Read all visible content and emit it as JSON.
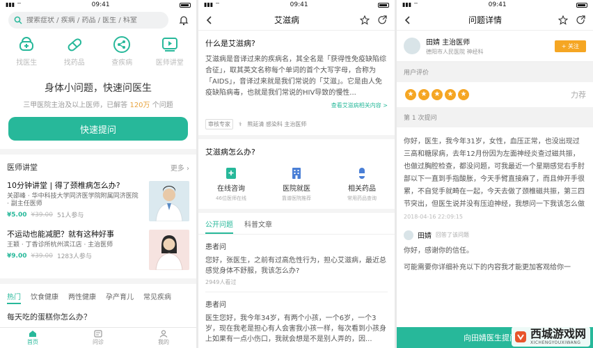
{
  "status": {
    "time": "09:41"
  },
  "home": {
    "search_placeholder": "搜索症状 / 疾病 / 药品 / 医生 / 科室",
    "categories": [
      {
        "label": "找医生",
        "icon": "doctor-icon"
      },
      {
        "label": "找药品",
        "icon": "pill-icon"
      },
      {
        "label": "查疾病",
        "icon": "share-icon"
      },
      {
        "label": "医师讲堂",
        "icon": "video-icon"
      }
    ],
    "hero_title": "身体小问题，快速问医生",
    "hero_sub_pre": "三甲医院主治及以上医师，已解答",
    "hero_sub_num": "120万",
    "hero_sub_post": "个问题",
    "ask_button": "快速提问",
    "lecture_section": "医师讲堂",
    "lecture_more": "更多",
    "lectures": [
      {
        "title": "10分钟讲堂 | 得了颈椎病怎么办?",
        "speaker": "关邵峰 · 华中科技大学同济医学院附属同济医院 · 副主任医师",
        "price": "¥5.00",
        "orig": "¥39.00",
        "count": "51人参与"
      },
      {
        "title": "不运动也能减肥？就有这种好事",
        "speaker": "王颖 · 丁香诊所杭州滨江店 · 主治医师",
        "price": "¥9.00",
        "orig": "¥39.00",
        "count": "1283人参与"
      }
    ],
    "tabs": [
      "热门",
      "饮食健康",
      "两性健康",
      "孕产育儿",
      "常见疾病"
    ],
    "cut_title": "每天吃的蛋糕你怎么办？",
    "nav": [
      {
        "label": "首页",
        "icon": "home-icon"
      },
      {
        "label": "问诊",
        "icon": "consult-icon"
      },
      {
        "label": "我的",
        "icon": "profile-icon"
      }
    ]
  },
  "disease": {
    "title": "艾滋病",
    "what_q": "什么是艾滋病?",
    "what_a": "艾滋病是音译过来的疾病名，其全名是「获得性免疫缺陷综合征」，取其英文名称每个单词的首个大写字母，合称为「AIDS」，音译过来就是我们常说的「艾滋」。它是由人免疫缺陷病毒，也就是我们常说的HIV导致的慢性...",
    "more_link": "查看艾滋病相关内容 >",
    "reviewer_tag": "审核专家",
    "reviewer": "熊延清 感染科 主治医师",
    "how_q": "艾滋病怎么办?",
    "services": [
      {
        "name": "在线咨询",
        "desc": "46位医师在线",
        "icon": "chat-plus-icon"
      },
      {
        "name": "医院就医",
        "desc": "靠谱医院推荐",
        "icon": "hospital-icon"
      },
      {
        "name": "相关药品",
        "desc": "常用药品查询",
        "icon": "medicine-icon"
      }
    ],
    "tabs": [
      "公开问题",
      "科普文章"
    ],
    "questions": [
      {
        "who": "患者问",
        "body": "您好，张医生，之前有过高危性行为，担心艾滋病，最近总感觉身体不舒服，我该怎么办?",
        "views": "2949人看过"
      },
      {
        "who": "患者问",
        "body": "医生您好，我今年34岁，有两个小孩，一个6岁，一个3岁，现在我老是担心有人会害我小孩一样，每次看到小孩身上如果有一点小伤口，我就会想是不是别人弄的，因..."
      }
    ]
  },
  "detail": {
    "title": "问题详情",
    "doctor_name": "田婧 主治医师",
    "doctor_hospital": "德阳市人民医院  神经科",
    "follow": "+ 关注",
    "rating_label": "用户评价",
    "rating_stars": 5,
    "rating_tag": "力荐",
    "round_label": "第 1 次提问",
    "question": "你好，医生，我今年31岁，女性，血压正常，也没出现过三高和糖尿病，去年12月份因为左面神经炎查过磁共振，也做过胸腔检查，都没问题，可我最近一个星期感觉右手肘部以下一直到手指酸胀，今天手臂直接麻了，而且伸开手很累，不自觉手就畸在一起，今天去做了颈椎磁共振，第三四节突出，但医生说并没有压迫神经，我想问一下我该怎么做",
    "time": "2018-04-16 22:09:15",
    "reply_name": "田婧",
    "reply_sub": "回答了该问题",
    "reply_text": "你好，感谢你的信任。",
    "reply_more": "可能需要你详细补充以下的内容我才能更加客观给你一",
    "cta": "向田婧医生提问",
    "watermark_main": "西城游戏网",
    "watermark_sub": "XICHENGYOUXIWANG"
  }
}
